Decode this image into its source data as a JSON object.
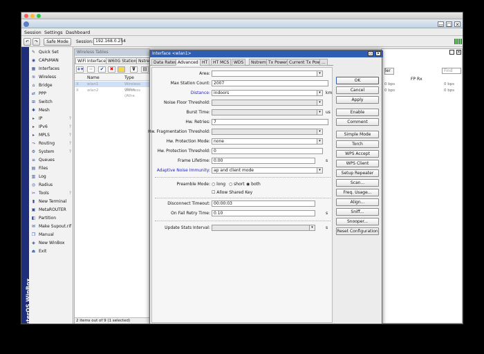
{
  "browser": {
    "title": ""
  },
  "menu": {
    "session": "Session",
    "settings": "Settings",
    "dashboard": "Dashboard"
  },
  "toolbar": {
    "undo_icon": "undo-icon",
    "redo_icon": "redo-icon",
    "safe_mode": "Safe Mode",
    "session_label": "Session:",
    "session_value": "192.168.0.254"
  },
  "brand": {
    "vertical_text": "RouterOS WinBox"
  },
  "sidebar": {
    "items": [
      {
        "label": "Quick Set",
        "icon": "quick-set-icon",
        "arrow": ""
      },
      {
        "label": "CAPsMAN",
        "icon": "capsman-icon",
        "arrow": ""
      },
      {
        "label": "Interfaces",
        "icon": "interfaces-icon",
        "arrow": ""
      },
      {
        "label": "Wireless",
        "icon": "wireless-icon",
        "arrow": ""
      },
      {
        "label": "Bridge",
        "icon": "bridge-icon",
        "arrow": ""
      },
      {
        "label": "PPP",
        "icon": "ppp-icon",
        "arrow": ""
      },
      {
        "label": "Switch",
        "icon": "switch-icon",
        "arrow": ""
      },
      {
        "label": "Mesh",
        "icon": "mesh-icon",
        "arrow": ""
      },
      {
        "label": "IP",
        "icon": "ip-icon",
        "arrow": "?"
      },
      {
        "label": "IPv6",
        "icon": "ipv6-icon",
        "arrow": "?"
      },
      {
        "label": "MPLS",
        "icon": "mpls-icon",
        "arrow": "?"
      },
      {
        "label": "Routing",
        "icon": "routing-icon",
        "arrow": "?"
      },
      {
        "label": "System",
        "icon": "system-icon",
        "arrow": "?"
      },
      {
        "label": "Queues",
        "icon": "queues-icon",
        "arrow": ""
      },
      {
        "label": "Files",
        "icon": "files-icon",
        "arrow": ""
      },
      {
        "label": "Log",
        "icon": "log-icon",
        "arrow": ""
      },
      {
        "label": "Radius",
        "icon": "radius-icon",
        "arrow": ""
      },
      {
        "label": "Tools",
        "icon": "tools-icon",
        "arrow": "?"
      },
      {
        "label": "New Terminal",
        "icon": "terminal-icon",
        "arrow": ""
      },
      {
        "label": "MetaROUTER",
        "icon": "metarouter-icon",
        "arrow": ""
      },
      {
        "label": "Partition",
        "icon": "partition-icon",
        "arrow": ""
      },
      {
        "label": "Make Supout.rif",
        "icon": "supout-icon",
        "arrow": ""
      },
      {
        "label": "Manual",
        "icon": "manual-icon",
        "arrow": ""
      },
      {
        "label": "New WinBox",
        "icon": "winbox-icon",
        "arrow": ""
      },
      {
        "label": "Exit",
        "icon": "exit-icon",
        "arrow": ""
      }
    ]
  },
  "wtable": {
    "title": "Wireless Tables",
    "tabs": [
      "WiFi Interfaces",
      "W60G Station",
      "Nstre"
    ],
    "columns": [
      "Name",
      "Type"
    ],
    "rows": [
      {
        "flag": "X",
        "name": "wlan1",
        "type": "Wireless (Athe"
      },
      {
        "flag": "X",
        "name": "wlan2",
        "type": "Wireless (Athe"
      }
    ],
    "status": "2 items out of 9 (1 selected)"
  },
  "bgright": {
    "col1": "FP Rx",
    "rows": [
      "0 bps",
      "0 bps"
    ],
    "left_rows": [
      "0 bps",
      "0 bps"
    ],
    "find": "Find",
    "btn": "ler"
  },
  "dialog": {
    "title": "Interface <wlan1>",
    "tabs": [
      "Data Rates",
      "Advanced",
      "HT",
      "HT MCS",
      "WDS",
      "Nstreme",
      "Tx Power",
      "Current Tx Power",
      "..."
    ],
    "fields": {
      "area": {
        "label": "Area:",
        "value": ""
      },
      "max_station": {
        "label": "Max Station Count:",
        "value": "2007"
      },
      "distance": {
        "label": "Distance:",
        "value": "indoors",
        "unit": "km"
      },
      "hw_floor": {
        "label": "Noise Floor Threshold:",
        "value": ""
      },
      "burst_time": {
        "label": "Burst Time:",
        "value": "",
        "unit": "us"
      },
      "hw_retries": {
        "label": "Hw. Retries:",
        "value": "7"
      },
      "hw_frag": {
        "label": "Hw. Fragmentation Threshold:",
        "value": ""
      },
      "hw_prot_mode": {
        "label": "Hw. Protection Mode:",
        "value": "none"
      },
      "hw_prot_thr": {
        "label": "Hw. Protection Threshold:",
        "value": "0"
      },
      "frame_lifetime": {
        "label": "Frame Lifetime:",
        "value": "0.00",
        "unit": "s"
      },
      "adaptive_noise": {
        "label": "Adaptive Noise Immunity:",
        "value": "ap and client mode"
      },
      "preamble": {
        "label": "Preamble Mode:",
        "options": [
          "long",
          "short",
          "both"
        ],
        "selected": "both"
      },
      "allow_shared": {
        "label": "Allow Shared Key"
      },
      "disc_timeout": {
        "label": "Disconnect Timeout:",
        "value": "00:00:03"
      },
      "on_fail": {
        "label": "On Fail Retry Time:",
        "value": "0.10",
        "unit": "s"
      },
      "update_stats": {
        "label": "Update Stats Interval:",
        "value": "",
        "unit": "s"
      }
    },
    "buttons": [
      "OK",
      "Cancel",
      "Apply",
      "Enable",
      "Comment",
      "Simple Mode",
      "Torch",
      "WPS Accept",
      "WPS Client",
      "Setup Repeater",
      "Scan...",
      "Freq. Usage...",
      "Align...",
      "Sniff...",
      "Snooper...",
      "Reset Configuration"
    ]
  },
  "colors": {
    "accent": "#2e5db3",
    "sidebar_strip": "#1f2e7a",
    "link_blue": "#2222cc"
  }
}
